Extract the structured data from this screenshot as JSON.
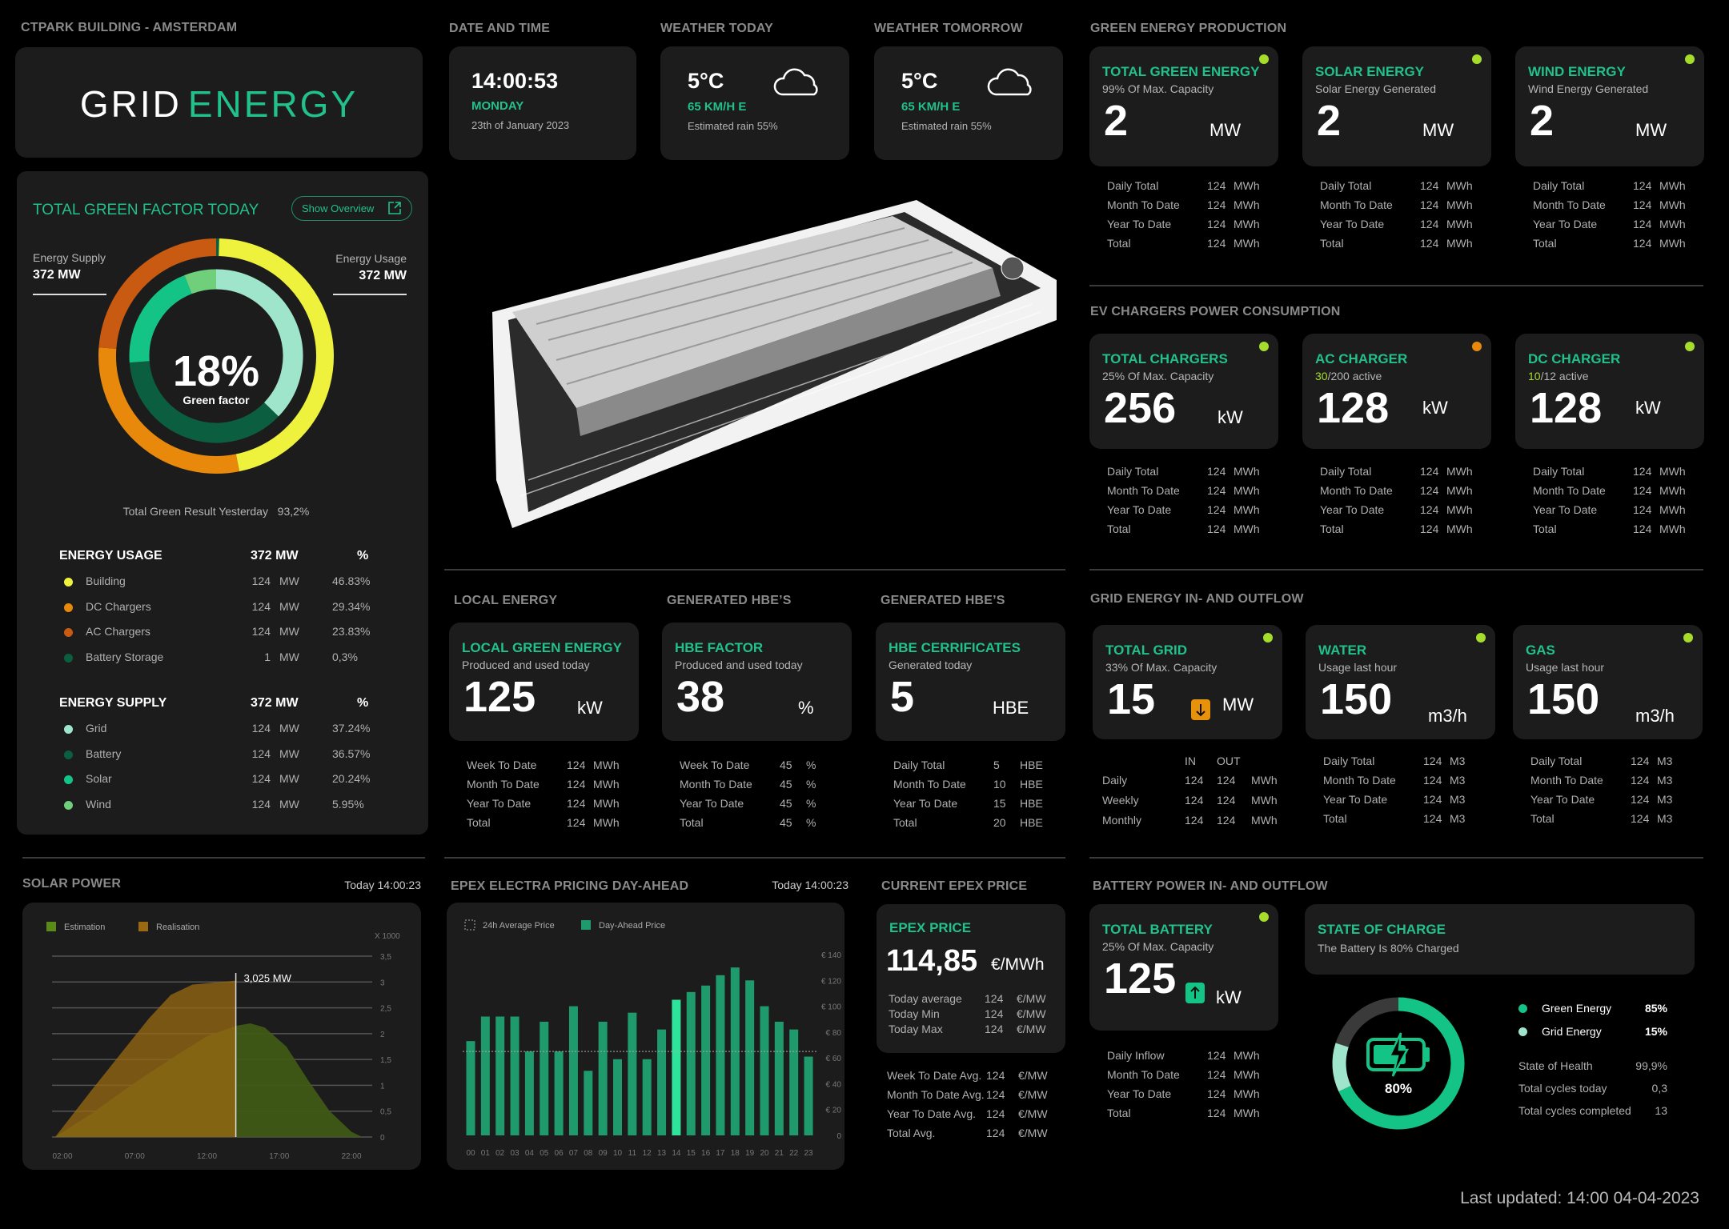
{
  "header": {
    "building": "CTPARK BUILDING - AMSTERDAM",
    "logo_a": "GRID",
    "logo_b": "ENERGY"
  },
  "colors": {
    "accent": "#22c08b",
    "status_ok": "#a6dc2c",
    "status_warn": "#e8890c",
    "card": "#1c1c1c",
    "background": "#000000"
  },
  "datetime": {
    "section": "DATE AND TIME",
    "time": "14:00:53",
    "day": "MONDAY",
    "date": "23th of January 2023"
  },
  "weather_today": {
    "section": "WEATHER TODAY",
    "temp": "5°C",
    "wind": "65 KM/H E",
    "rain": "Estimated rain 55%",
    "icon": "cloud-icon"
  },
  "weather_tomorrow": {
    "section": "WEATHER TOMORROW",
    "temp": "5°C",
    "wind": "65 KM/H E",
    "rain": "Estimated rain 55%",
    "icon": "cloud-icon"
  },
  "green_factor": {
    "title": "TOTAL GREEN FACTOR TODAY",
    "button": "Show Overview",
    "supply_label": "Energy Supply",
    "supply_value": "372 MW",
    "usage_label": "Energy Usage",
    "usage_value": "372 MW",
    "percent": "18%",
    "center_label": "Green factor",
    "yesterday_label": "Total Green Result Yesterday",
    "yesterday_value": "93,2%",
    "usage": {
      "title": "ENERGY USAGE",
      "total": "372 MW",
      "pct_header": "%",
      "items": [
        {
          "name": "Building",
          "value": "124",
          "unit": "MW",
          "pct": "46.83%",
          "share": 46.83,
          "color": "#eef23c"
        },
        {
          "name": "DC Chargers",
          "value": "124",
          "unit": "MW",
          "pct": "29.34%",
          "share": 29.34,
          "color": "#e8890c"
        },
        {
          "name": "AC Chargers",
          "value": "124",
          "unit": "MW",
          "pct": "23.83%",
          "share": 23.83,
          "color": "#c85a12"
        },
        {
          "name": "Battery Storage",
          "value": "1",
          "unit": "MW",
          "pct": "0,3%",
          "share": 0.3,
          "color": "#0b5e40"
        }
      ]
    },
    "supply": {
      "title": "ENERGY SUPPLY",
      "total": "372 MW",
      "pct_header": "%",
      "items": [
        {
          "name": "Grid",
          "value": "124",
          "unit": "MW",
          "pct": "37.24%",
          "share": 37.24,
          "color": "#9fe5cc"
        },
        {
          "name": "Battery",
          "value": "124",
          "unit": "MW",
          "pct": "36.57%",
          "share": 36.57,
          "color": "#0b5e40"
        },
        {
          "name": "Solar",
          "value": "124",
          "unit": "MW",
          "pct": "20.24%",
          "share": 20.24,
          "color": "#14c486"
        },
        {
          "name": "Wind",
          "value": "124",
          "unit": "MW",
          "pct": "5.95%",
          "share": 5.95,
          "color": "#6fcf7a"
        }
      ]
    }
  },
  "green_production": {
    "section": "GREEN ENERGY PRODUCTION",
    "cards": [
      {
        "title": "TOTAL GREEN ENERGY",
        "subtitle": "99% Of Max. Capacity",
        "value": "2",
        "unit": "MW",
        "status": "#a6dc2c",
        "rows": [
          [
            "Daily Total",
            "124",
            "MWh"
          ],
          [
            "Month To Date",
            "124",
            "MWh"
          ],
          [
            "Year To Date",
            "124",
            "MWh"
          ],
          [
            "Total",
            "124",
            "MWh"
          ]
        ]
      },
      {
        "title": "SOLAR ENERGY",
        "subtitle": "Solar Energy Generated",
        "value": "2",
        "unit": "MW",
        "status": "#a6dc2c",
        "rows": [
          [
            "Daily Total",
            "124",
            "MWh"
          ],
          [
            "Month To Date",
            "124",
            "MWh"
          ],
          [
            "Year To Date",
            "124",
            "MWh"
          ],
          [
            "Total",
            "124",
            "MWh"
          ]
        ]
      },
      {
        "title": "WIND ENERGY",
        "subtitle": "Wind Energy Generated",
        "value": "2",
        "unit": "MW",
        "status": "#a6dc2c",
        "rows": [
          [
            "Daily Total",
            "124",
            "MWh"
          ],
          [
            "Month To Date",
            "124",
            "MWh"
          ],
          [
            "Year To Date",
            "124",
            "MWh"
          ],
          [
            "Total",
            "124",
            "MWh"
          ]
        ]
      }
    ]
  },
  "ev_chargers": {
    "section": "EV CHARGERS POWER CONSUMPTION",
    "cards": [
      {
        "title": "TOTAL CHARGERS",
        "subtitle": "25% Of Max. Capacity",
        "value": "256",
        "unit": "kW",
        "status": "#a6dc2c",
        "rows": [
          [
            "Daily Total",
            "124",
            "MWh"
          ],
          [
            "Month To Date",
            "124",
            "MWh"
          ],
          [
            "Year To Date",
            "124",
            "MWh"
          ],
          [
            "Total",
            "124",
            "MWh"
          ]
        ]
      },
      {
        "title": "AC CHARGER",
        "subtitle_hl": "30",
        "subtitle": "/200 active",
        "value": "128",
        "unit": "kW",
        "status": "#e8890c",
        "rows": [
          [
            "Daily Total",
            "124",
            "MWh"
          ],
          [
            "Month To Date",
            "124",
            "MWh"
          ],
          [
            "Year To Date",
            "124",
            "MWh"
          ],
          [
            "Total",
            "124",
            "MWh"
          ]
        ]
      },
      {
        "title": "DC CHARGER",
        "subtitle_hl": "10",
        "subtitle": "/12 active",
        "value": "128",
        "unit": "kW",
        "status": "#a6dc2c",
        "rows": [
          [
            "Daily Total",
            "124",
            "MWh"
          ],
          [
            "Month To Date",
            "124",
            "MWh"
          ],
          [
            "Year To Date",
            "124",
            "MWh"
          ],
          [
            "Total",
            "124",
            "MWh"
          ]
        ]
      }
    ]
  },
  "grid_flow": {
    "section": "GRID ENERGY IN- AND OUTFLOW",
    "cards": [
      {
        "title": "TOTAL GRID",
        "subtitle": "33% Of Max. Capacity",
        "value": "15",
        "unit": "MW",
        "status": "#a6dc2c",
        "arrow": "arrow-down-icon",
        "header": [
          "",
          "IN",
          "OUT",
          ""
        ],
        "rows": [
          [
            "Daily",
            "124",
            "124",
            "MWh"
          ],
          [
            "Weekly",
            "124",
            "124",
            "MWh"
          ],
          [
            "Monthly",
            "124",
            "124",
            "MWh"
          ]
        ]
      },
      {
        "title": "WATER",
        "subtitle": "Usage last hour",
        "value": "150",
        "unit": "m3/h",
        "status": "#a6dc2c",
        "rows": [
          [
            "Daily Total",
            "124",
            "M3"
          ],
          [
            "Month To Date",
            "124",
            "M3"
          ],
          [
            "Year To Date",
            "124",
            "M3"
          ],
          [
            "Total",
            "124",
            "M3"
          ]
        ]
      },
      {
        "title": "GAS",
        "subtitle": "Usage last hour",
        "value": "150",
        "unit": "m3/h",
        "status": "#a6dc2c",
        "rows": [
          [
            "Daily Total",
            "124",
            "M3"
          ],
          [
            "Month To Date",
            "124",
            "M3"
          ],
          [
            "Year To Date",
            "124",
            "M3"
          ],
          [
            "Total",
            "124",
            "M3"
          ]
        ]
      }
    ]
  },
  "local": {
    "cards": [
      {
        "section": "LOCAL ENERGY",
        "title": "LOCAL GREEN ENERGY",
        "subtitle": "Produced and used today",
        "value": "125",
        "unit": "kW",
        "rows": [
          [
            "Week To Date",
            "124",
            "MWh"
          ],
          [
            "Month To Date",
            "124",
            "MWh"
          ],
          [
            "Year To Date",
            "124",
            "MWh"
          ],
          [
            "Total",
            "124",
            "MWh"
          ]
        ]
      },
      {
        "section": "GENERATED HBE’S",
        "title": "HBE FACTOR",
        "subtitle": "Produced and used today",
        "value": "38",
        "unit": "%",
        "rows": [
          [
            "Week To Date",
            "45",
            "%"
          ],
          [
            "Month To Date",
            "45",
            "%"
          ],
          [
            "Year To Date",
            "45",
            "%"
          ],
          [
            "Total",
            "45",
            "%"
          ]
        ]
      },
      {
        "section": "GENERATED HBE’S",
        "title": "HBE CERRIFICATES",
        "subtitle": "Generated today",
        "value": "5",
        "unit": "HBE",
        "rows": [
          [
            "Daily Total",
            "5",
            "HBE"
          ],
          [
            "Month To Date",
            "10",
            "HBE"
          ],
          [
            "Year To Date",
            "15",
            "HBE"
          ],
          [
            "Total",
            "20",
            "HBE"
          ]
        ]
      }
    ]
  },
  "epex": {
    "section": "CURRENT EPEX PRICE",
    "title": "EPEX PRICE",
    "value": "114,85",
    "unit": "€/MWh",
    "inner_rows": [
      [
        "Today average",
        "124",
        "€/MW"
      ],
      [
        "Today Min",
        "124",
        "€/MW"
      ],
      [
        "Today Max",
        "124",
        "€/MW"
      ]
    ],
    "rows": [
      [
        "Week To Date Avg.",
        "124",
        "€/MW"
      ],
      [
        "Month To Date Avg.",
        "124",
        "€/MW"
      ],
      [
        "Year To Date Avg.",
        "124",
        "€/MW"
      ],
      [
        "Total Avg.",
        "124",
        "€/MW"
      ]
    ]
  },
  "battery": {
    "section": "BATTERY POWER IN- AND OUTFLOW",
    "card": {
      "title": "TOTAL BATTERY",
      "subtitle": "25% Of Max. Capacity",
      "value": "125",
      "unit": "kW",
      "status": "#a6dc2c",
      "arrow": "arrow-up-icon",
      "rows": [
        [
          "Daily Inflow",
          "124",
          "MWh"
        ],
        [
          "Month To Date",
          "124",
          "MWh"
        ],
        [
          "Year To Date",
          "124",
          "MWh"
        ],
        [
          "Total",
          "124",
          "MWh"
        ]
      ]
    },
    "soc": {
      "title": "STATE OF CHARGE",
      "subtitle": "The Battery Is 80% Charged",
      "percent_label": "80%",
      "charge": 80,
      "legend": [
        {
          "name": "Green Energy",
          "pct": "85%",
          "share": 85,
          "color": "#14c486"
        },
        {
          "name": "Grid Energy",
          "pct": "15%",
          "share": 15,
          "color": "#9fe5cc"
        }
      ],
      "stats": [
        [
          "State of Health",
          "99,9%"
        ],
        [
          "Total cycles today",
          "0,3"
        ],
        [
          "Total cycles completed",
          "13"
        ]
      ]
    }
  },
  "last_updated": "Last updated: 14:00 04-04-2023",
  "chart_data": [
    {
      "type": "area",
      "title": "SOLAR POWER",
      "timestamp": "Today 14:00:23",
      "unit_label": "X 1000",
      "xlabel": "",
      "ylabel": "",
      "ylim": [
        0,
        3.5
      ],
      "grid": true,
      "legend_position": "top-left",
      "x_ticks": [
        "02:00",
        "07:00",
        "12:00",
        "17:00",
        "22:00"
      ],
      "y_ticks": [
        "0",
        "0,5",
        "1",
        "1,5",
        "2",
        "2,5",
        "3",
        "3,5"
      ],
      "annotation": "3,025 MW",
      "annotation_x": "14:00",
      "series": [
        {
          "name": "Estimation",
          "color": "#3f5a16",
          "points": [
            [
              "01:30",
              0
            ],
            [
              "04:00",
              0.45
            ],
            [
              "07:00",
              1.05
            ],
            [
              "10:00",
              1.6
            ],
            [
              "12:00",
              1.95
            ],
            [
              "14:00",
              2.15
            ],
            [
              "15:00",
              2.2
            ],
            [
              "16:00",
              2.12
            ],
            [
              "17:30",
              1.75
            ],
            [
              "19:00",
              1.1
            ],
            [
              "20:30",
              0.5
            ],
            [
              "22:00",
              0.1
            ],
            [
              "22:45",
              0
            ]
          ]
        },
        {
          "name": "Realisation",
          "color": "#9a6a12",
          "points": [
            [
              "01:30",
              0
            ],
            [
              "04:00",
              0.9
            ],
            [
              "06:00",
              1.6
            ],
            [
              "08:00",
              2.3
            ],
            [
              "09:30",
              2.75
            ],
            [
              "11:00",
              2.95
            ],
            [
              "13:00",
              3.0
            ],
            [
              "14:00",
              3.025
            ]
          ]
        }
      ]
    },
    {
      "type": "bar",
      "title": "EPEX  ELECTRA PRICING DAY-AHEAD",
      "timestamp": "Today 14:00:23",
      "xlabel": "",
      "ylabel": "",
      "ylim": [
        0,
        140
      ],
      "grid": false,
      "legend_position": "top-left",
      "y_ticks": [
        "0",
        "€ 20",
        "€ 40",
        "€ 60",
        "€ 80",
        "€ 100",
        "€ 120",
        "€ 140"
      ],
      "categories": [
        "00",
        "01",
        "02",
        "03",
        "04",
        "05",
        "06",
        "07",
        "08",
        "09",
        "10",
        "11",
        "12",
        "13",
        "14",
        "15",
        "16",
        "17",
        "18",
        "19",
        "20",
        "21",
        "22",
        "23"
      ],
      "series": [
        {
          "name": "Day-Ahead Price",
          "color": "#1f9a6c",
          "highlight_index": 14,
          "highlight_color": "#2ee39a",
          "values": [
            73,
            92,
            92,
            92,
            65,
            88,
            65,
            100,
            50,
            88,
            59,
            95,
            59,
            82,
            105,
            111,
            116,
            124,
            130,
            120,
            100,
            88,
            82,
            61
          ]
        },
        {
          "name": "24h Average Price",
          "style": "dotted",
          "value": 65
        }
      ]
    }
  ]
}
